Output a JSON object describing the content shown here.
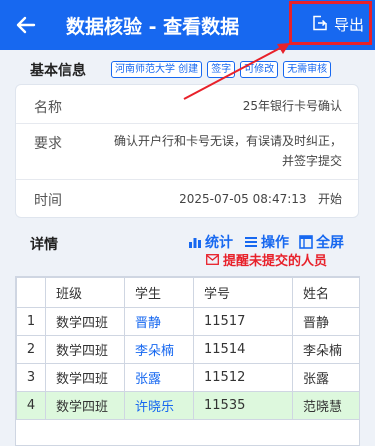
{
  "header": {
    "title": "数据核验 - 查看数据",
    "export_label": "导出"
  },
  "basic": {
    "heading": "基本信息",
    "tags": [
      "河南师范大学 创建",
      "签字",
      "可修改",
      "无需审核"
    ]
  },
  "card": {
    "name_label": "名称",
    "name_value": "25年银行卡号确认",
    "req_label": "要求",
    "req_line1": "确认开户行和卡号无误，有误请及时纠正，",
    "req_line2": "并签字提交",
    "time_label": "时间",
    "time_value": "2025-07-05 08:47:13",
    "time_status": "开始"
  },
  "details": {
    "heading": "详情",
    "stats": "统计",
    "ops": "操作",
    "fullscreen": "全屏",
    "remind": "提醒未提交的人员"
  },
  "table": {
    "headers": [
      "",
      "班级",
      "学生",
      "学号",
      "姓名"
    ],
    "rows": [
      {
        "idx": "1",
        "cls": "数学四班",
        "stu": "晋静",
        "id": "11517",
        "name": "晋静"
      },
      {
        "idx": "2",
        "cls": "数学四班",
        "stu": "李朵楠",
        "id": "11514",
        "name": "李朵楠"
      },
      {
        "idx": "3",
        "cls": "数学四班",
        "stu": "张露",
        "id": "11512",
        "name": "张露"
      },
      {
        "idx": "4",
        "cls": "数学四班",
        "stu": "许晓乐",
        "id": "11535",
        "name": "范晓慧"
      }
    ]
  },
  "colors": {
    "primary": "#1768f0",
    "danger": "#e8212a",
    "highlight": "#ddf8dd"
  }
}
